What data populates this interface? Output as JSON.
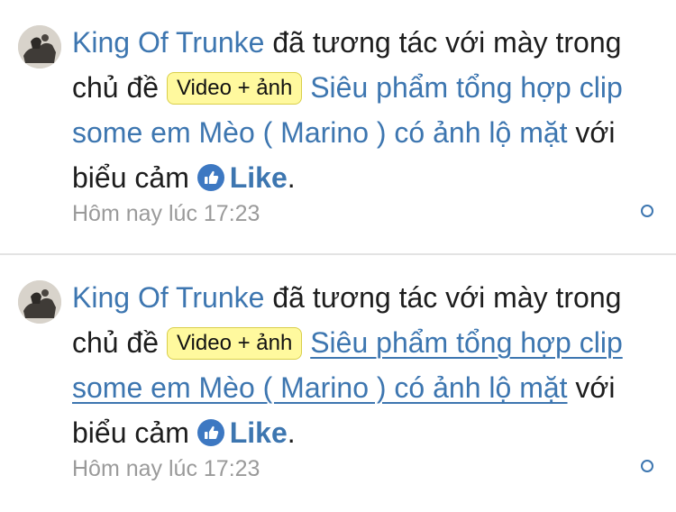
{
  "alerts": [
    {
      "username": "King Of Trunke",
      "action_text": "đã tương tác với mày trong chủ đề",
      "thread_prefix": "Video + ảnh",
      "thread_title": "Siêu phẩm tổng hợp clip some em Mèo ( Marino ) có ảnh lộ mặt",
      "reaction_intro": "với biểu cảm",
      "reaction_label": "Like",
      "end_punct": ".",
      "timestamp": "Hôm nay lúc 17:23"
    },
    {
      "username": "King Of Trunke",
      "action_text": "đã tương tác với mày trong chủ đề",
      "thread_prefix": "Video + ảnh",
      "thread_title": "Siêu phẩm tổng hợp clip some em Mèo ( Marino ) có ảnh lộ mặt",
      "reaction_intro": "với biểu cảm",
      "reaction_label": "Like",
      "end_punct": ".",
      "timestamp": "Hôm nay lúc 17:23"
    }
  ],
  "colors": {
    "link": "#3d76b0",
    "prefix_bg": "#fff99e",
    "time": "#9a9a9a"
  },
  "icons": {
    "reaction": "like-thumb-icon",
    "unread": "unread-circle-icon"
  }
}
